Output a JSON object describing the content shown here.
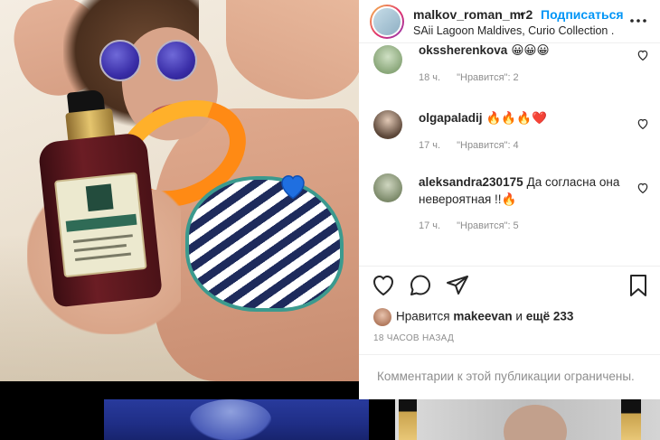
{
  "header": {
    "username": "malkov_roman_mr2",
    "separator": "•",
    "follow_label": "Подписаться",
    "location": "SAii Lagoon Maldives, Curio Collection ...",
    "more_icon": "more-horizontal-icon"
  },
  "comments": [
    {
      "username": "okssherenkova",
      "text": "😀😀😀",
      "time": "18 ч.",
      "likes": "\"Нравится\": 2"
    },
    {
      "username": "olgapaladij",
      "text": "🔥🔥🔥❤️",
      "time": "17 ч.",
      "likes": "\"Нравится\": 4"
    },
    {
      "username": "aleksandra230175",
      "text": "Да согласна она невероятная !!🔥",
      "time": "17 ч.",
      "likes": "\"Нравится\": 5"
    }
  ],
  "actions": {
    "like_icon": "heart-icon",
    "comment_icon": "comment-icon",
    "share_icon": "paper-plane-icon",
    "save_icon": "bookmark-icon"
  },
  "likes": {
    "prefix": "Нравится",
    "user": "makeevan",
    "connector": "и",
    "others": "ещё 233"
  },
  "timeago": "18 часов назад",
  "comments_limited": "Комментарии к этой публикации ограничены.",
  "colors": {
    "accent": "#0095f6",
    "text": "#262626",
    "muted": "#8e8e8e",
    "divider": "#efefef"
  }
}
